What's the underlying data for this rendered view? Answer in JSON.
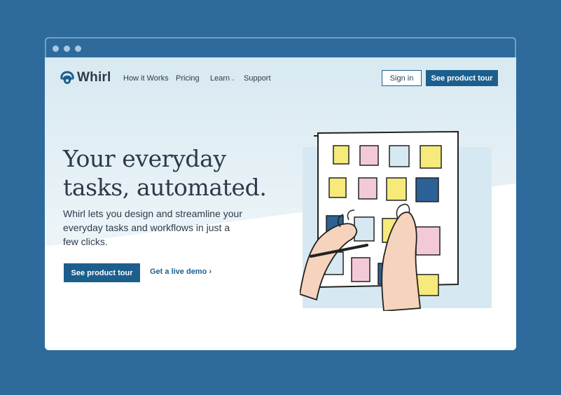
{
  "window": {
    "controls": [
      "close-dot",
      "minimize-dot",
      "maximize-dot"
    ]
  },
  "nav": {
    "logo_text": "Whirl",
    "links": [
      "How it Works",
      "Pricing",
      "Learn",
      "Support"
    ],
    "learn_chevron": "⌄",
    "sign_in": "Sign in",
    "product_tour": "See product tour"
  },
  "hero": {
    "title_line1": "Your everyday",
    "title_line2": "tasks, automated.",
    "subtitle": "Whirl lets you design and streamline your everyday tasks and workflows in just a few clicks.",
    "cta_primary": "See product tour",
    "cta_secondary": "Get a live demo ›"
  },
  "colors": {
    "background": "#2e6b9c",
    "primary": "#1c5f8d",
    "text": "#2d3a4a",
    "note_yellow": "#f5ea7a",
    "note_pink": "#f3c9d8",
    "note_lightblue": "#d6e9f2",
    "note_darkblue": "#2b6196"
  },
  "illustration": {
    "subject": "hands arranging sticky notes on a board"
  }
}
